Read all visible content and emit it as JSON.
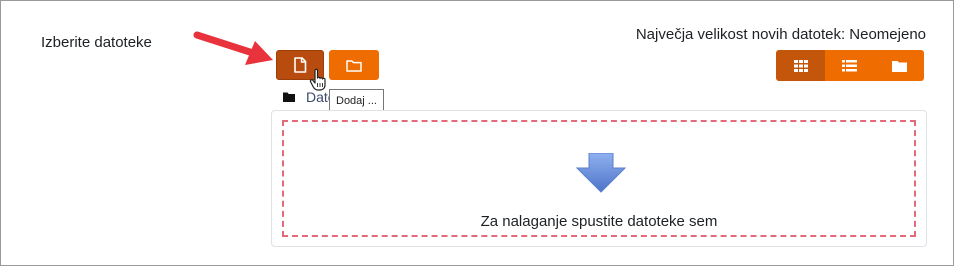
{
  "filepicker": {
    "field_label": "Izberite datoteke",
    "max_size_text": "Največja velikost novih datotek: Neomejeno",
    "buttons": [
      {
        "name": "add-file-button",
        "icon": "file-icon"
      },
      {
        "name": "create-folder-button",
        "icon": "folder-icon"
      }
    ],
    "view_buttons": [
      {
        "icon": "grid-icon",
        "active": true
      },
      {
        "icon": "list-icon",
        "active": false
      },
      {
        "icon": "folder-icon",
        "active": false
      }
    ],
    "path_label": "Datoteke",
    "tooltip": "Dodaj ...",
    "drop_text": "Za nalaganje spustite datoteke sem"
  },
  "colors": {
    "accent": "#ef6c00",
    "accent_active": "#b74c0e",
    "dropzone_border": "#e36a78",
    "annotation_arrow": "#e8323c",
    "drop_arrow": "#6b8fdc"
  }
}
